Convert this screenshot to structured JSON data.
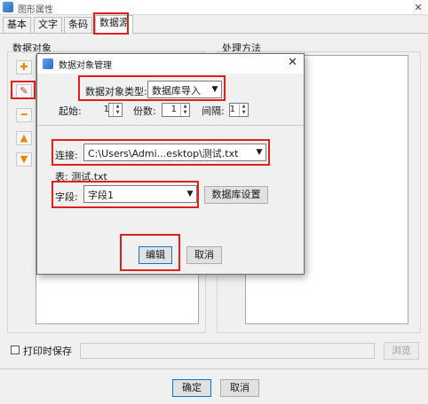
{
  "outer": {
    "title": "图形属性",
    "tabs": [
      {
        "label": "基本"
      },
      {
        "label": "文字"
      },
      {
        "label": "条码"
      },
      {
        "label": "数据源"
      }
    ],
    "data_objects_label": "数据对象",
    "processing_label": "处理方法",
    "save_on_print_label": "打印时保存",
    "browse_label": "浏览",
    "ok_label": "确定",
    "cancel_label": "取消"
  },
  "dialog": {
    "title": "数据对象管理",
    "type_label": "数据对象类型:",
    "type_value": "数据库导入",
    "start_label": "起始:",
    "start_value": "1",
    "copies_label": "份数:",
    "copies_value": "1",
    "interval_label": "间隔:",
    "interval_value": "1",
    "connect_label": "连接:",
    "connect_value": "C:\\Users\\Admi...esktop\\测试.txt",
    "table_label": "表: 测试.txt",
    "field_label": "字段:",
    "field_value": "字段1",
    "db_settings_label": "数据库设置",
    "edit_label": "编辑",
    "cancel_label": "取消"
  },
  "colors": {
    "highlight_red": "#e0201b",
    "window_bg": "#f0f0f0"
  }
}
